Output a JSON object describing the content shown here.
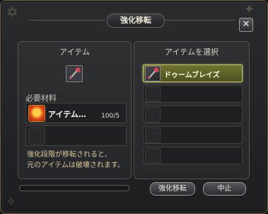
{
  "window": {
    "title": "強化移転"
  },
  "left_panel": {
    "header": "アイテム",
    "target_icon": "weapon-axe-icon",
    "materials_label": "必要材料",
    "materials": [
      {
        "name": "アイテム…",
        "count": "100/5",
        "icon": "red-gem-icon"
      },
      {
        "name": "",
        "count": "",
        "icon": "empty-slot-icon"
      }
    ],
    "warning_lines": [
      "強化段階が移転されると、",
      "元のアイテムは破壊されます。"
    ]
  },
  "right_panel": {
    "header": "アイテムを選択",
    "items": [
      {
        "label": "ドゥームブレイズ",
        "selected": true,
        "icon": "weapon-axe-icon"
      },
      {
        "label": "",
        "selected": false
      },
      {
        "label": "",
        "selected": false
      },
      {
        "label": "",
        "selected": false
      },
      {
        "label": "",
        "selected": false
      }
    ]
  },
  "progress": {
    "value": 0
  },
  "buttons": {
    "transfer": "強化移転",
    "cancel": "中止"
  },
  "colors": {
    "selected_slot": "#5d6128",
    "warning_text": "#d9c79c"
  }
}
